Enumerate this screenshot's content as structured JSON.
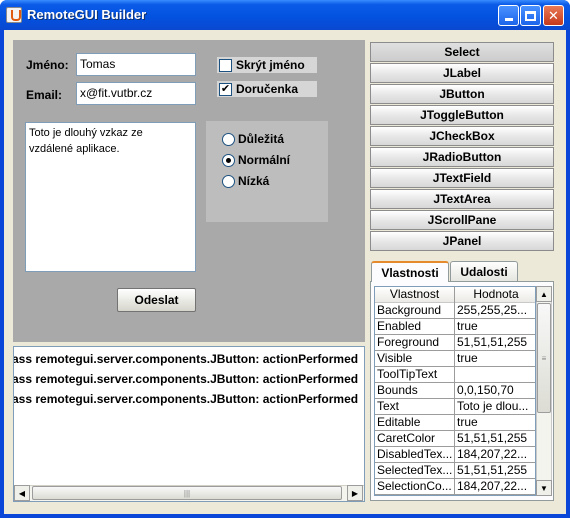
{
  "window": {
    "title": "RemoteGUI Builder",
    "minimize_icon": "minimize-icon",
    "maximize_icon": "maximize-icon",
    "close_label": "✕"
  },
  "form": {
    "name_label": "Jméno:",
    "name_value": "Tomas",
    "email_label": "Email:",
    "email_value": "x@fit.vutbr.cz",
    "hide_name_label": "Skrýt jméno",
    "hide_name_checked": false,
    "receipt_label": "Doručenka",
    "receipt_checked": true,
    "message_text": "Toto je dlouhý vzkaz ze\nvzdálené aplikace.",
    "priority_options": [
      "Důležitá",
      "Normální",
      "Nízká"
    ],
    "priority_selected": "Normální",
    "send_label": "Odeslat"
  },
  "console": {
    "lines": [
      "ass remotegui.server.components.JButton: actionPerformed",
      "ass remotegui.server.components.JButton: actionPerformed",
      "ass remotegui.server.components.JButton: actionPerformed"
    ]
  },
  "palette": {
    "items": [
      "Select",
      "JLabel",
      "JButton",
      "JToggleButton",
      "JCheckBox",
      "JRadioButton",
      "JTextField",
      "JTextArea",
      "JScrollPane",
      "JPanel"
    ],
    "active": "Select"
  },
  "inspector": {
    "tabs": [
      "Vlastnosti",
      "Udalosti"
    ],
    "active_tab": "Vlastnosti",
    "columns": [
      "Vlastnost",
      "Hodnota"
    ],
    "rows": [
      [
        "Background",
        "255,255,25..."
      ],
      [
        "Enabled",
        "true"
      ],
      [
        "Foreground",
        "51,51,51,255"
      ],
      [
        "Visible",
        "true"
      ],
      [
        "ToolTipText",
        ""
      ],
      [
        "Bounds",
        "0,0,150,70"
      ],
      [
        "Text",
        "Toto je dlou..."
      ],
      [
        "Editable",
        "true"
      ],
      [
        "CaretColor",
        "51,51,51,255"
      ],
      [
        "DisabledTex...",
        "184,207,22..."
      ],
      [
        "SelectedTex...",
        "51,51,51,255"
      ],
      [
        "SelectionCo...",
        "184,207,22..."
      ]
    ]
  },
  "colors": {
    "title_bar": "#0352e0",
    "window_bg": "#ece9d8",
    "form_panel_bg": "#a9a9a9",
    "radio_panel_bg": "#bdbdbd",
    "tab_accent": "#e68b2c"
  }
}
